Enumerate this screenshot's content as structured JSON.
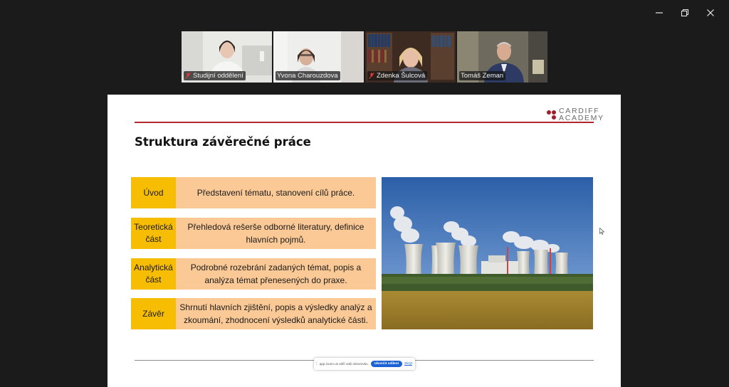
{
  "window": {
    "controls": [
      {
        "name": "minimize",
        "icon": "minimize-icon"
      },
      {
        "name": "restore",
        "icon": "restore-icon"
      },
      {
        "name": "close",
        "icon": "close-icon"
      }
    ]
  },
  "participants": [
    {
      "name": "Studijní oddělení",
      "muted": true,
      "active": false
    },
    {
      "name": "Yvona Charouzdova",
      "muted": false,
      "active": false
    },
    {
      "name": "Zdenka Šulcová",
      "muted": true,
      "active": false
    },
    {
      "name": "Tomáš Zeman",
      "muted": false,
      "active": true
    }
  ],
  "slide": {
    "logo_line1": "CARDIFF",
    "logo_line2": "ACADEMY",
    "title": "Struktura závěrečné práce",
    "rows": [
      {
        "key": "Úvod",
        "value": "Představení tématu, stanovení cílů práce."
      },
      {
        "key": "Teoretická část",
        "value": "Přehledová rešerše odborné literatury, definice hlavních pojmů."
      },
      {
        "key": "Analytická část",
        "value": "Podrobné rozebrání zadaných témat, popis a analýza témat přenesených do praxe."
      },
      {
        "key": "Závěr",
        "value": "Shrnutí hlavních zjištění, popis a výsledky analýz a zkoumání, zhodnocení výsledků analytické části."
      }
    ]
  },
  "share_bar": {
    "message": "app.zoom.us sdílí vaši obrazovku.",
    "stop_label": "Ukončit sdílení",
    "hide_label": "Skrýt"
  },
  "colors": {
    "accent_line": "#b3282d",
    "key_fill": "#f7bd03",
    "value_fill": "#fbc995",
    "active_speaker": "#2fd38c",
    "stop_button": "#1a62d6"
  }
}
